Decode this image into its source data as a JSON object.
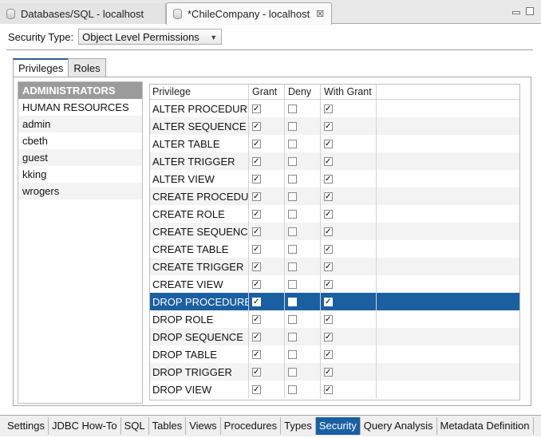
{
  "editor_tabs": [
    {
      "label": "Databases/SQL - localhost"
    },
    {
      "label": "*ChileCompany - localhost",
      "close": "☒"
    }
  ],
  "security_type": {
    "label": "Security Type:",
    "value": "Object Level Permissions"
  },
  "panel_tabs": [
    {
      "label": "Privileges"
    },
    {
      "label": "Roles"
    }
  ],
  "roles": [
    "ADMINISTRATORS",
    "HUMAN RESOURCES",
    "admin",
    "cbeth",
    "guest",
    "kking",
    "wrogers"
  ],
  "privilege_table": {
    "headers": [
      "Privilege",
      "Grant",
      "Deny",
      "With Grant"
    ],
    "rows": [
      {
        "name": "ALTER PROCEDURE",
        "grant": true,
        "deny": false,
        "with_grant": true
      },
      {
        "name": "ALTER SEQUENCE",
        "grant": true,
        "deny": false,
        "with_grant": true
      },
      {
        "name": "ALTER TABLE",
        "grant": true,
        "deny": false,
        "with_grant": true
      },
      {
        "name": "ALTER TRIGGER",
        "grant": true,
        "deny": false,
        "with_grant": true
      },
      {
        "name": "ALTER VIEW",
        "grant": true,
        "deny": false,
        "with_grant": true
      },
      {
        "name": "CREATE PROCEDURE",
        "grant": true,
        "deny": false,
        "with_grant": true
      },
      {
        "name": "CREATE ROLE",
        "grant": true,
        "deny": false,
        "with_grant": true
      },
      {
        "name": "CREATE SEQUENCE",
        "grant": true,
        "deny": false,
        "with_grant": true
      },
      {
        "name": "CREATE TABLE",
        "grant": true,
        "deny": false,
        "with_grant": true
      },
      {
        "name": "CREATE TRIGGER",
        "grant": true,
        "deny": false,
        "with_grant": true
      },
      {
        "name": "CREATE VIEW",
        "grant": true,
        "deny": false,
        "with_grant": true
      },
      {
        "name": "DROP PROCEDURE",
        "grant": true,
        "deny": false,
        "with_grant": true
      },
      {
        "name": "DROP ROLE",
        "grant": true,
        "deny": false,
        "with_grant": true
      },
      {
        "name": "DROP SEQUENCE",
        "grant": true,
        "deny": false,
        "with_grant": true
      },
      {
        "name": "DROP TABLE",
        "grant": true,
        "deny": false,
        "with_grant": true
      },
      {
        "name": "DROP TRIGGER",
        "grant": true,
        "deny": false,
        "with_grant": true
      },
      {
        "name": "DROP VIEW",
        "grant": true,
        "deny": false,
        "with_grant": true
      }
    ]
  },
  "bottom_tabs": [
    "Settings",
    "JDBC How-To",
    "SQL",
    "Tables",
    "Views",
    "Procedures",
    "Types",
    "Security",
    "Query Analysis",
    "Metadata Definition"
  ],
  "colors": {
    "selection": "#1a5fa0",
    "selected_role": "#9b9b9b",
    "active_tab": "#1a5fa0"
  }
}
